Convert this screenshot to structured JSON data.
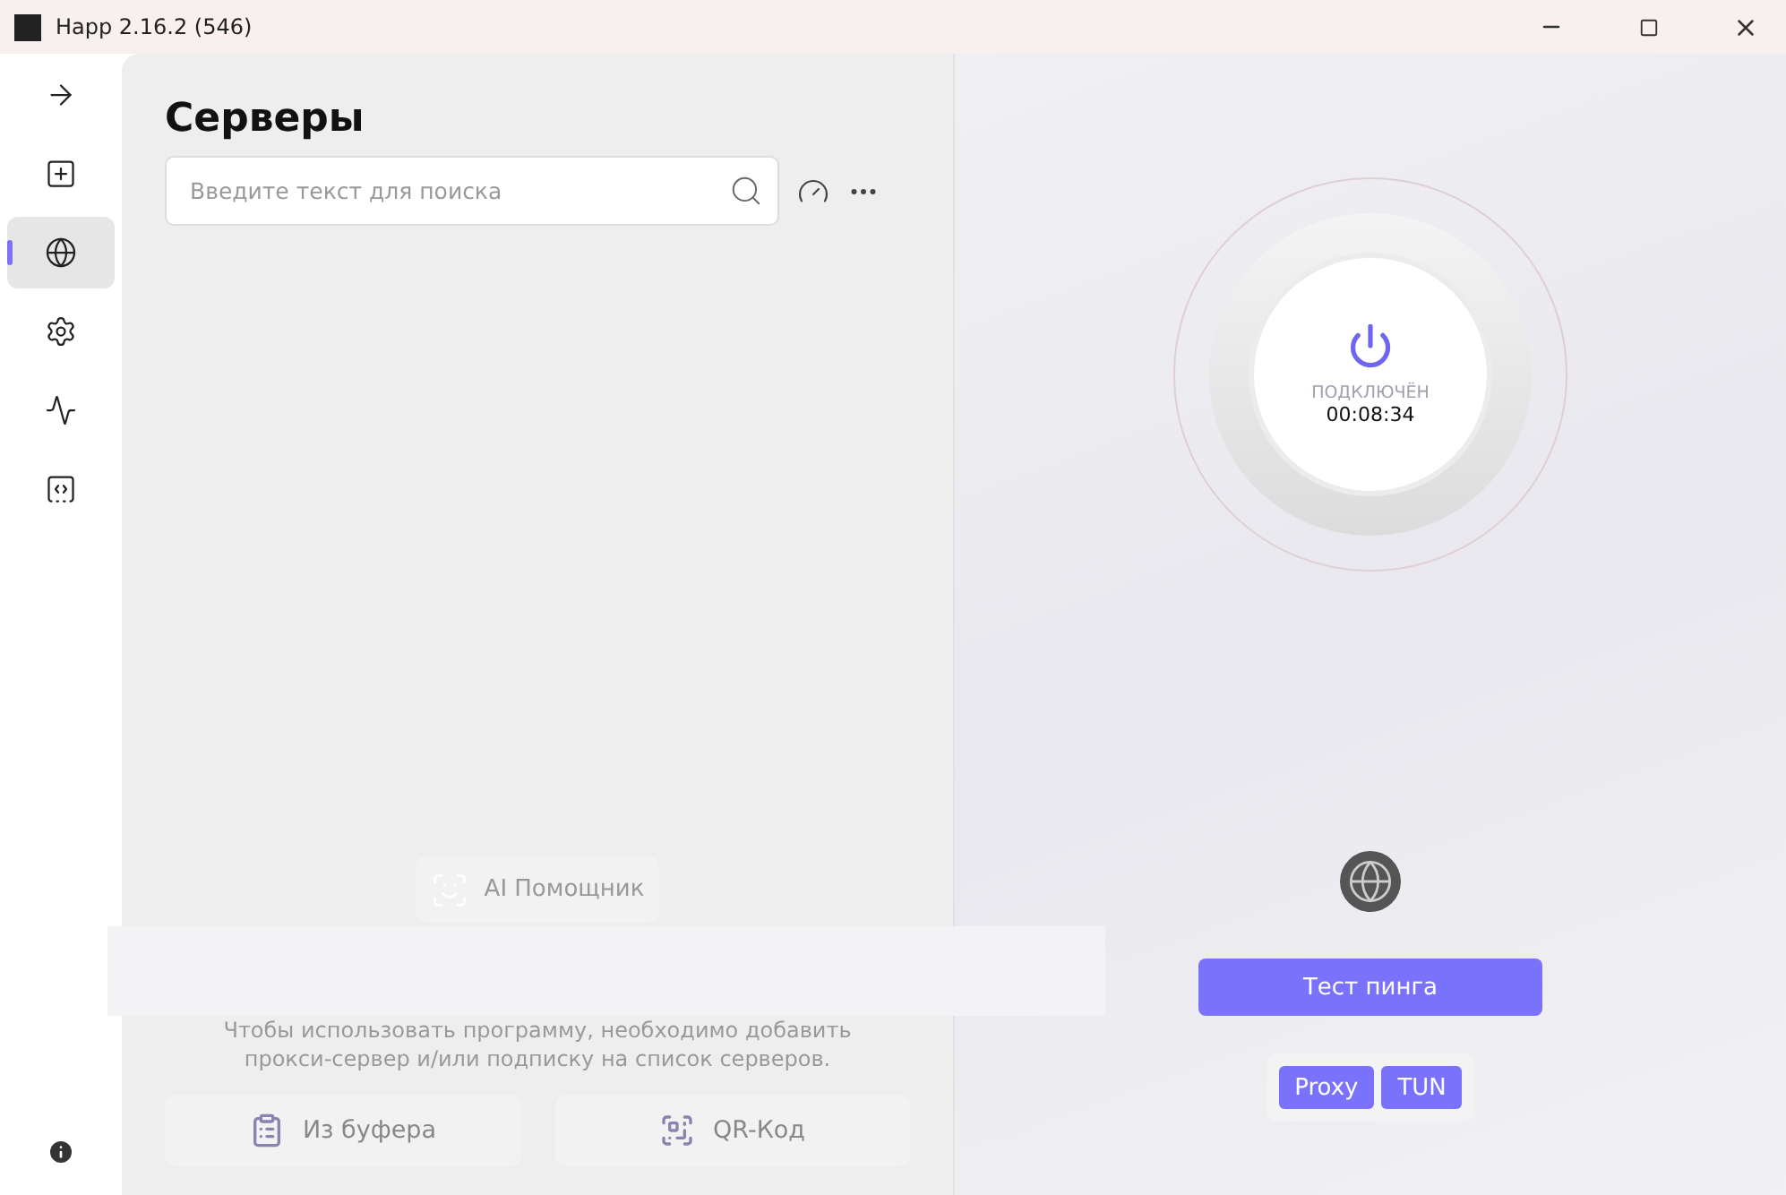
{
  "window": {
    "title": "Happ 2.16.2 (546)"
  },
  "sidebar": {
    "items": [
      {
        "selected": false
      },
      {
        "selected": false
      },
      {
        "selected": true
      },
      {
        "selected": false
      },
      {
        "selected": false
      },
      {
        "selected": false
      }
    ]
  },
  "servers": {
    "title": "Серверы",
    "search": {
      "placeholder": "Введите текст для поиска"
    },
    "assistant_button": "AI Помощник",
    "empty_message": "Чтобы использовать программу, необходимо добавить прокси-сервер и/или подписку на список серверов.",
    "actions": [
      {
        "kind": "clipboard",
        "label": "Из буфера"
      },
      {
        "kind": "qr",
        "label": "QR-Код"
      }
    ]
  },
  "connection": {
    "status": "ПОДКЛЮЧЁН",
    "time": "00:08:34",
    "connected": true,
    "ping_button": "Тест пинга",
    "modes": [
      {
        "label": "Proxy",
        "selected": true
      },
      {
        "label": "TUN",
        "selected": true
      }
    ]
  }
}
